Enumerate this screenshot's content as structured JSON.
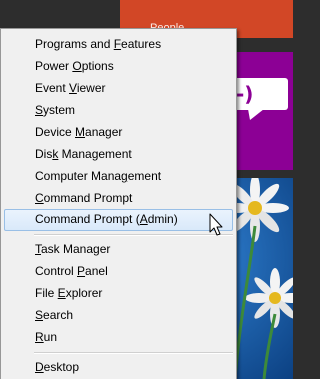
{
  "background_tiles": {
    "orange_tile_label": "People",
    "colors": {
      "orange": "#d24726",
      "purple": "#8c0095",
      "photo_blue": "#0f4f97",
      "dark_bg": "#2d2d2d"
    }
  },
  "menu": {
    "items": [
      {
        "pre": "Programs and ",
        "ul": "F",
        "post": "eatures"
      },
      {
        "pre": "Power ",
        "ul": "O",
        "post": "ptions"
      },
      {
        "pre": "Event ",
        "ul": "V",
        "post": "iewer"
      },
      {
        "pre": "",
        "ul": "S",
        "post": "ystem"
      },
      {
        "pre": "Device ",
        "ul": "M",
        "post": "anager"
      },
      {
        "pre": "Dis",
        "ul": "k",
        "post": " Management"
      },
      {
        "pre": "Computer Mana",
        "ul": "g",
        "post": "ement"
      },
      {
        "pre": "",
        "ul": "C",
        "post": "ommand Prompt"
      },
      {
        "pre": "Command Prompt (",
        "ul": "A",
        "post": "dmin)"
      },
      {
        "pre": "",
        "ul": "T",
        "post": "ask Manager"
      },
      {
        "pre": "Control ",
        "ul": "P",
        "post": "anel"
      },
      {
        "pre": "File ",
        "ul": "E",
        "post": "xplorer"
      },
      {
        "pre": "",
        "ul": "S",
        "post": "earch"
      },
      {
        "pre": "",
        "ul": "R",
        "post": "un"
      },
      {
        "pre": "",
        "ul": "D",
        "post": "esktop"
      }
    ],
    "highlighted_item": "Command Prompt (Admin)",
    "highlight_color": "#d9e9fa"
  }
}
